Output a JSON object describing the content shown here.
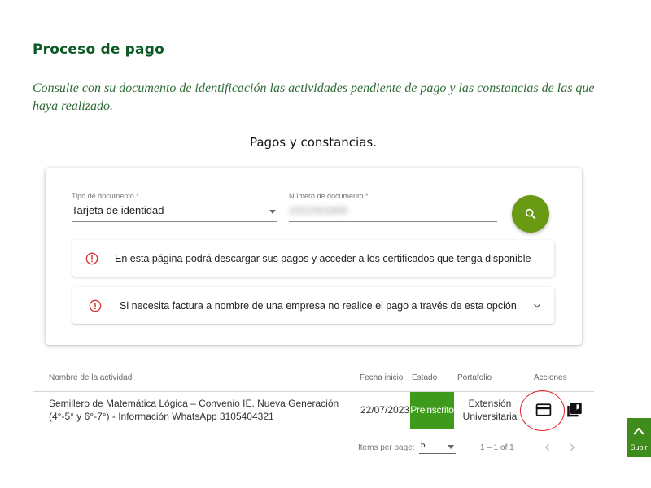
{
  "page": {
    "title": "Proceso de pago",
    "intro": "Consulte con su documento de identificación las actividades pendiente de pago y las constancias de las que haya realizado.",
    "section_title": "Pagos y constancias."
  },
  "form": {
    "doc_type_label": "Tipo de documento *",
    "doc_type_value": "Tarjeta de identidad",
    "doc_number_label": "Número de documento *",
    "doc_number_value": "1021501600",
    "search_icon": "search-icon",
    "accent_color": "#6a9a14"
  },
  "notices": [
    {
      "icon": "alert-circle-icon",
      "text": "En esta página podrá descargar sus pagos y acceder a los certificados que tenga disponible"
    },
    {
      "icon": "alert-circle-icon",
      "text": "Si necesita factura a nombre de una empresa no realice el pago a través de esta opción",
      "expand_icon": "chevron-down-icon"
    }
  ],
  "table": {
    "headers": {
      "name": "Nombre de la actividad",
      "date": "Fecha inicio",
      "state": "Estado",
      "portfolio": "Portafolio",
      "actions": "Acciones"
    },
    "rows": [
      {
        "name": "Semillero de Matemática Lógica – Convenio IE. Nueva Generación (4°-5° y 6°-7°) - Información WhatsApp 3105404321",
        "date": "22/07/2023",
        "state": "Preinscrito",
        "state_color": "#3d9a1a",
        "portfolio": "Extensión Universitaria",
        "actions": [
          "credit-card-icon",
          "library-books-icon"
        ]
      }
    ]
  },
  "paginator": {
    "items_label": "Items per page:",
    "page_size": "5",
    "range": "1 – 1 of 1"
  },
  "scroll_top": {
    "label": "Subir",
    "color": "#3d8c1c"
  }
}
